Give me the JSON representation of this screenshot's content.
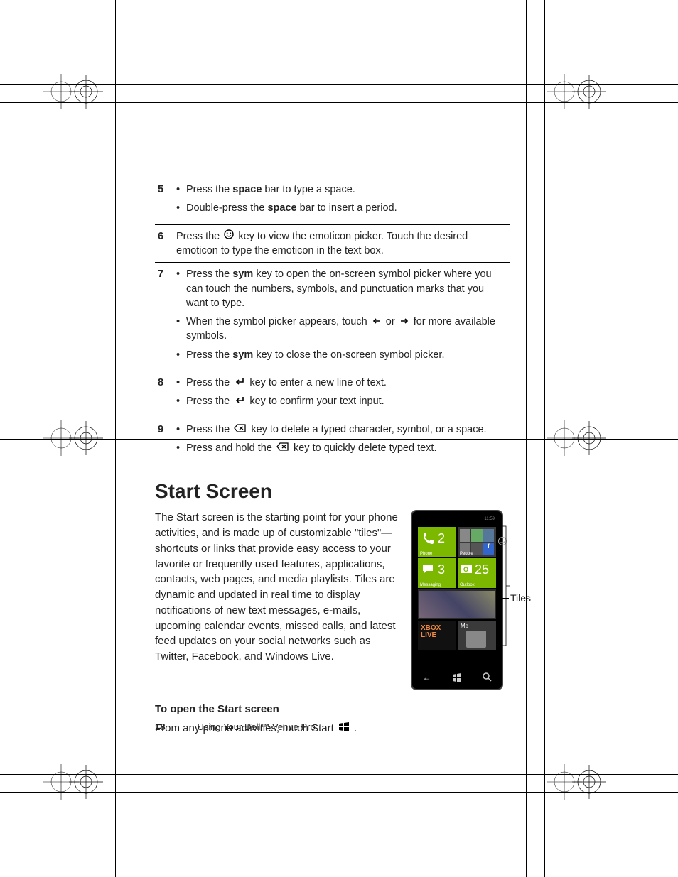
{
  "footer": {
    "page_number": "18",
    "section": "Using Your Dell™ Venue Pro"
  },
  "rows": {
    "r5": {
      "num": "5",
      "b1a": "Press the ",
      "b1b": "space",
      "b1c": " bar to type a space.",
      "b2a": "Double-press the ",
      "b2b": "space",
      "b2c": " bar to insert a period."
    },
    "r6": {
      "num": "6",
      "texta": "Press the ",
      "textb": " key to view the emoticon picker. Touch the desired emoticon to type the emoticon in the text box."
    },
    "r7": {
      "num": "7",
      "b1a": "Press the ",
      "b1b": "sym",
      "b1c": " key to open the on-screen symbol picker where you can touch the numbers, symbols, and punctuation marks that you want to type.",
      "b2a": "When the symbol picker appears, touch ",
      "b2b": " or ",
      "b2c": " for more available symbols.",
      "b3a": "Press the ",
      "b3b": "sym",
      "b3c": " key to close the on-screen symbol picker."
    },
    "r8": {
      "num": "8",
      "b1a": "Press the ",
      "b1b": " key to enter a new line of text.",
      "b2a": "Press the ",
      "b2b": " key to confirm your text input."
    },
    "r9": {
      "num": "9",
      "b1a": "Press the ",
      "b1b": " key to delete a typed character, symbol, or a space.",
      "b2a": "Press and hold the ",
      "b2b": " key to quickly delete typed text."
    }
  },
  "section": {
    "title": "Start Screen",
    "body": "The Start screen is the starting point for your phone activities, and is made up of customizable \"tiles\"—shortcuts or links that provide easy access to your favorite or frequently used features, applications, contacts, web pages, and media playlists. Tiles are dynamic and updated in real time to display notifications of new text messages, e-mails, upcoming calendar events, missed calls, and latest feed updates on your social networks such as Twitter, Facebook, and Windows Live.",
    "subhead": "To open the Start screen",
    "sub_body_a": "From any phone activities, touch Start ",
    "sub_body_b": ".",
    "tiles_label": "Tiles"
  },
  "phone": {
    "time": "11:59",
    "phone_count": "2",
    "phone_label": "Phone",
    "people_label": "People",
    "msg_count": "3",
    "msg_label": "Messaging",
    "outlook_count": "25",
    "outlook_label": "Outlook",
    "xbox": "XBOX LIVE",
    "me": "Me",
    "arrow": "→"
  }
}
